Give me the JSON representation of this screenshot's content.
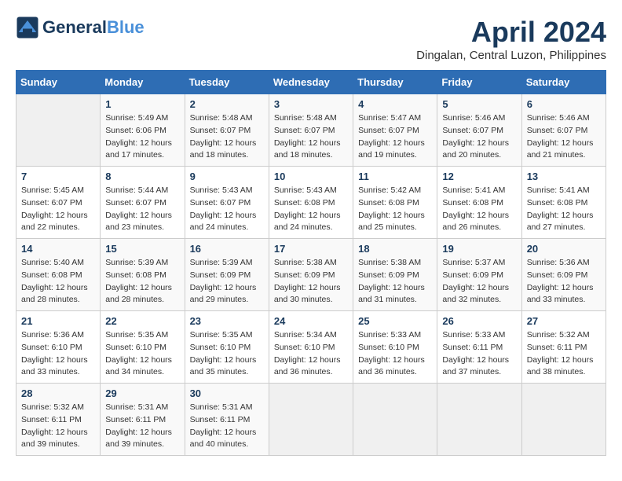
{
  "header": {
    "logo_line1": "General",
    "logo_line2": "Blue",
    "month_title": "April 2024",
    "location": "Dingalan, Central Luzon, Philippines"
  },
  "calendar": {
    "weekdays": [
      "Sunday",
      "Monday",
      "Tuesday",
      "Wednesday",
      "Thursday",
      "Friday",
      "Saturday"
    ],
    "weeks": [
      [
        {
          "day": "",
          "info": ""
        },
        {
          "day": "1",
          "info": "Sunrise: 5:49 AM\nSunset: 6:06 PM\nDaylight: 12 hours\nand 17 minutes."
        },
        {
          "day": "2",
          "info": "Sunrise: 5:48 AM\nSunset: 6:07 PM\nDaylight: 12 hours\nand 18 minutes."
        },
        {
          "day": "3",
          "info": "Sunrise: 5:48 AM\nSunset: 6:07 PM\nDaylight: 12 hours\nand 18 minutes."
        },
        {
          "day": "4",
          "info": "Sunrise: 5:47 AM\nSunset: 6:07 PM\nDaylight: 12 hours\nand 19 minutes."
        },
        {
          "day": "5",
          "info": "Sunrise: 5:46 AM\nSunset: 6:07 PM\nDaylight: 12 hours\nand 20 minutes."
        },
        {
          "day": "6",
          "info": "Sunrise: 5:46 AM\nSunset: 6:07 PM\nDaylight: 12 hours\nand 21 minutes."
        }
      ],
      [
        {
          "day": "7",
          "info": "Sunrise: 5:45 AM\nSunset: 6:07 PM\nDaylight: 12 hours\nand 22 minutes."
        },
        {
          "day": "8",
          "info": "Sunrise: 5:44 AM\nSunset: 6:07 PM\nDaylight: 12 hours\nand 23 minutes."
        },
        {
          "day": "9",
          "info": "Sunrise: 5:43 AM\nSunset: 6:07 PM\nDaylight: 12 hours\nand 24 minutes."
        },
        {
          "day": "10",
          "info": "Sunrise: 5:43 AM\nSunset: 6:08 PM\nDaylight: 12 hours\nand 24 minutes."
        },
        {
          "day": "11",
          "info": "Sunrise: 5:42 AM\nSunset: 6:08 PM\nDaylight: 12 hours\nand 25 minutes."
        },
        {
          "day": "12",
          "info": "Sunrise: 5:41 AM\nSunset: 6:08 PM\nDaylight: 12 hours\nand 26 minutes."
        },
        {
          "day": "13",
          "info": "Sunrise: 5:41 AM\nSunset: 6:08 PM\nDaylight: 12 hours\nand 27 minutes."
        }
      ],
      [
        {
          "day": "14",
          "info": "Sunrise: 5:40 AM\nSunset: 6:08 PM\nDaylight: 12 hours\nand 28 minutes."
        },
        {
          "day": "15",
          "info": "Sunrise: 5:39 AM\nSunset: 6:08 PM\nDaylight: 12 hours\nand 28 minutes."
        },
        {
          "day": "16",
          "info": "Sunrise: 5:39 AM\nSunset: 6:09 PM\nDaylight: 12 hours\nand 29 minutes."
        },
        {
          "day": "17",
          "info": "Sunrise: 5:38 AM\nSunset: 6:09 PM\nDaylight: 12 hours\nand 30 minutes."
        },
        {
          "day": "18",
          "info": "Sunrise: 5:38 AM\nSunset: 6:09 PM\nDaylight: 12 hours\nand 31 minutes."
        },
        {
          "day": "19",
          "info": "Sunrise: 5:37 AM\nSunset: 6:09 PM\nDaylight: 12 hours\nand 32 minutes."
        },
        {
          "day": "20",
          "info": "Sunrise: 5:36 AM\nSunset: 6:09 PM\nDaylight: 12 hours\nand 33 minutes."
        }
      ],
      [
        {
          "day": "21",
          "info": "Sunrise: 5:36 AM\nSunset: 6:10 PM\nDaylight: 12 hours\nand 33 minutes."
        },
        {
          "day": "22",
          "info": "Sunrise: 5:35 AM\nSunset: 6:10 PM\nDaylight: 12 hours\nand 34 minutes."
        },
        {
          "day": "23",
          "info": "Sunrise: 5:35 AM\nSunset: 6:10 PM\nDaylight: 12 hours\nand 35 minutes."
        },
        {
          "day": "24",
          "info": "Sunrise: 5:34 AM\nSunset: 6:10 PM\nDaylight: 12 hours\nand 36 minutes."
        },
        {
          "day": "25",
          "info": "Sunrise: 5:33 AM\nSunset: 6:10 PM\nDaylight: 12 hours\nand 36 minutes."
        },
        {
          "day": "26",
          "info": "Sunrise: 5:33 AM\nSunset: 6:11 PM\nDaylight: 12 hours\nand 37 minutes."
        },
        {
          "day": "27",
          "info": "Sunrise: 5:32 AM\nSunset: 6:11 PM\nDaylight: 12 hours\nand 38 minutes."
        }
      ],
      [
        {
          "day": "28",
          "info": "Sunrise: 5:32 AM\nSunset: 6:11 PM\nDaylight: 12 hours\nand 39 minutes."
        },
        {
          "day": "29",
          "info": "Sunrise: 5:31 AM\nSunset: 6:11 PM\nDaylight: 12 hours\nand 39 minutes."
        },
        {
          "day": "30",
          "info": "Sunrise: 5:31 AM\nSunset: 6:11 PM\nDaylight: 12 hours\nand 40 minutes."
        },
        {
          "day": "",
          "info": ""
        },
        {
          "day": "",
          "info": ""
        },
        {
          "day": "",
          "info": ""
        },
        {
          "day": "",
          "info": ""
        }
      ]
    ]
  }
}
